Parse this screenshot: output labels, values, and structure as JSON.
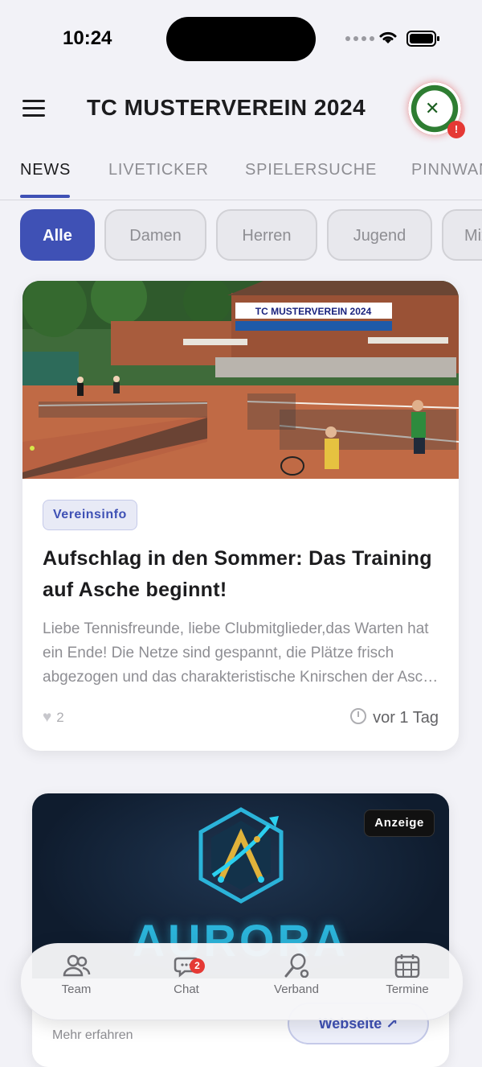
{
  "status_bar": {
    "time": "10:24"
  },
  "header": {
    "title": "TC MUSTERVEREIN 2024",
    "badge": "!"
  },
  "tabs": [
    {
      "label": "NEWS",
      "active": true
    },
    {
      "label": "LIVETICKER",
      "active": false
    },
    {
      "label": "SPIELERSUCHE",
      "active": false
    },
    {
      "label": "PINNWAND",
      "active": false
    }
  ],
  "filters": [
    {
      "label": "Alle",
      "active": true
    },
    {
      "label": "Damen",
      "active": false
    },
    {
      "label": "Herren",
      "active": false
    },
    {
      "label": "Jugend",
      "active": false
    },
    {
      "label": "Mixed",
      "active": false
    }
  ],
  "news": [
    {
      "image_sign": "TC MUSTERVEREIN 2024",
      "category": "Vereinsinfo",
      "title": "Aufschlag in den Sommer: Das Training auf Asche beginnt!",
      "excerpt": "Liebe Tennisfreunde, liebe Clubmitglieder,das Warten hat ein Ende! Die Netze sind gespannt, die Plätze frisch abgezogen und das charakteristische Knirschen der Asche ist zurück.",
      "likes": "2",
      "age": "vor 1 Tag"
    }
  ],
  "ad": {
    "label": "Anzeige",
    "brand": "AURORA",
    "more": "Mehr erfahren",
    "website": "Webseite ↗"
  },
  "bottom_nav": [
    {
      "label": "Team",
      "icon": "team-icon"
    },
    {
      "label": "Chat",
      "icon": "chat-icon",
      "badge": "2"
    },
    {
      "label": "Verband",
      "icon": "racket-icon"
    },
    {
      "label": "Termine",
      "icon": "calendar-icon"
    }
  ],
  "colors": {
    "accent": "#3f51b5",
    "badge": "#e53935",
    "clay": "#c06a45"
  }
}
